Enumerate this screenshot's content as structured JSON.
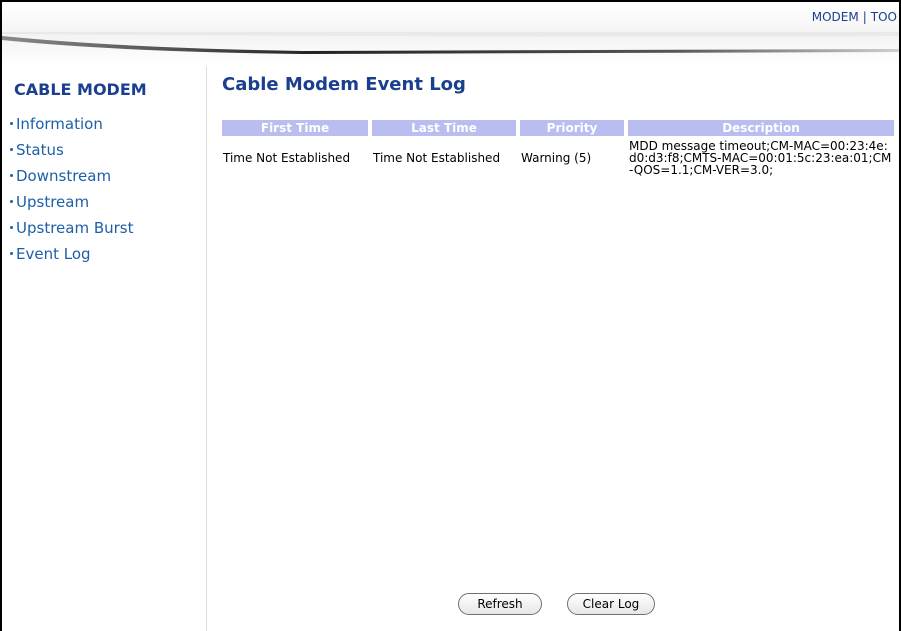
{
  "topnav": {
    "modem_label": "MODEM",
    "separator": "|",
    "tools_label": "TOO"
  },
  "sidebar": {
    "title": "CABLE MODEM",
    "items": [
      {
        "label": "Information"
      },
      {
        "label": "Status"
      },
      {
        "label": "Downstream"
      },
      {
        "label": "Upstream"
      },
      {
        "label": "Upstream Burst"
      },
      {
        "label": "Event Log"
      }
    ]
  },
  "main": {
    "title": "Cable Modem Event Log",
    "table": {
      "headers": [
        "First Time",
        "Last Time",
        "Priority",
        "Description"
      ],
      "rows": [
        {
          "first_time": "Time Not Established",
          "last_time": "Time Not Established",
          "priority": "Warning (5)",
          "description": "MDD message timeout;CM-MAC=00:23:4e:d0:d3:f8;CMTS-MAC=00:01:5c:23:ea:01;CM-QOS=1.1;CM-VER=3.0;"
        }
      ]
    }
  },
  "buttons": {
    "refresh_label": "Refresh",
    "clear_log_label": "Clear Log"
  },
  "colors": {
    "brand": "#1a3f8f",
    "link": "#1d5fa8",
    "table_header_bg": "#b9bdf0"
  }
}
